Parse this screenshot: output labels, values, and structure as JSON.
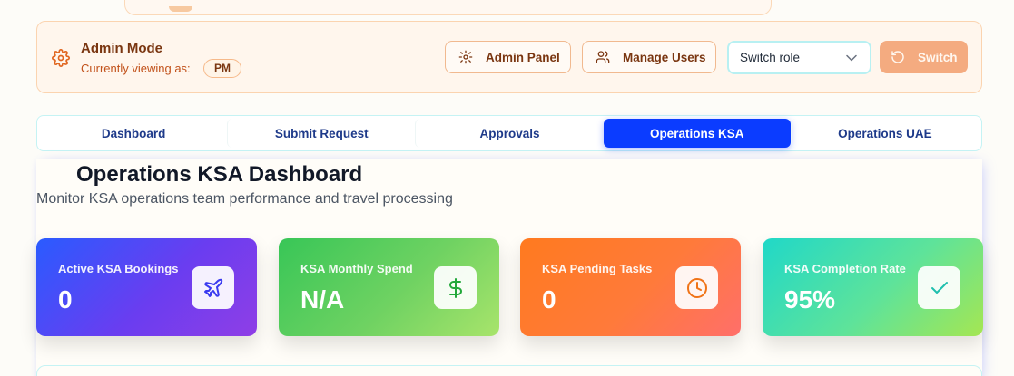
{
  "admin": {
    "title": "Admin Mode",
    "viewing_label": "Currently viewing as:",
    "current_role": "PM",
    "admin_panel_label": "Admin Panel",
    "manage_users_label": "Manage Users",
    "role_select_value": "Switch role",
    "switch_label": "Switch"
  },
  "tabs": [
    {
      "label": "Dashboard",
      "active": false
    },
    {
      "label": "Submit Request",
      "active": false
    },
    {
      "label": "Approvals",
      "active": false
    },
    {
      "label": "Operations KSA",
      "active": true
    },
    {
      "label": "Operations UAE",
      "active": false
    }
  ],
  "page": {
    "title": "Operations KSA Dashboard",
    "subtitle": "Monitor KSA operations team performance and travel processing"
  },
  "stats": [
    {
      "label": "Active KSA Bookings",
      "value": "0",
      "icon": "plane-icon",
      "icon_color": "#3b3bf0"
    },
    {
      "label": "KSA Monthly Spend",
      "value": "N/A",
      "icon": "dollar-icon",
      "icon_color": "#22a83a"
    },
    {
      "label": "KSA Pending Tasks",
      "value": "0",
      "icon": "clock-icon",
      "icon_color": "#f07317"
    },
    {
      "label": "KSA Completion Rate",
      "value": "95%",
      "icon": "check-icon",
      "icon_color": "#1fbfae"
    }
  ],
  "colors": {
    "accent": "#0b3cff",
    "admin_text": "#7a3611",
    "admin_bg": "#fff6ed"
  }
}
